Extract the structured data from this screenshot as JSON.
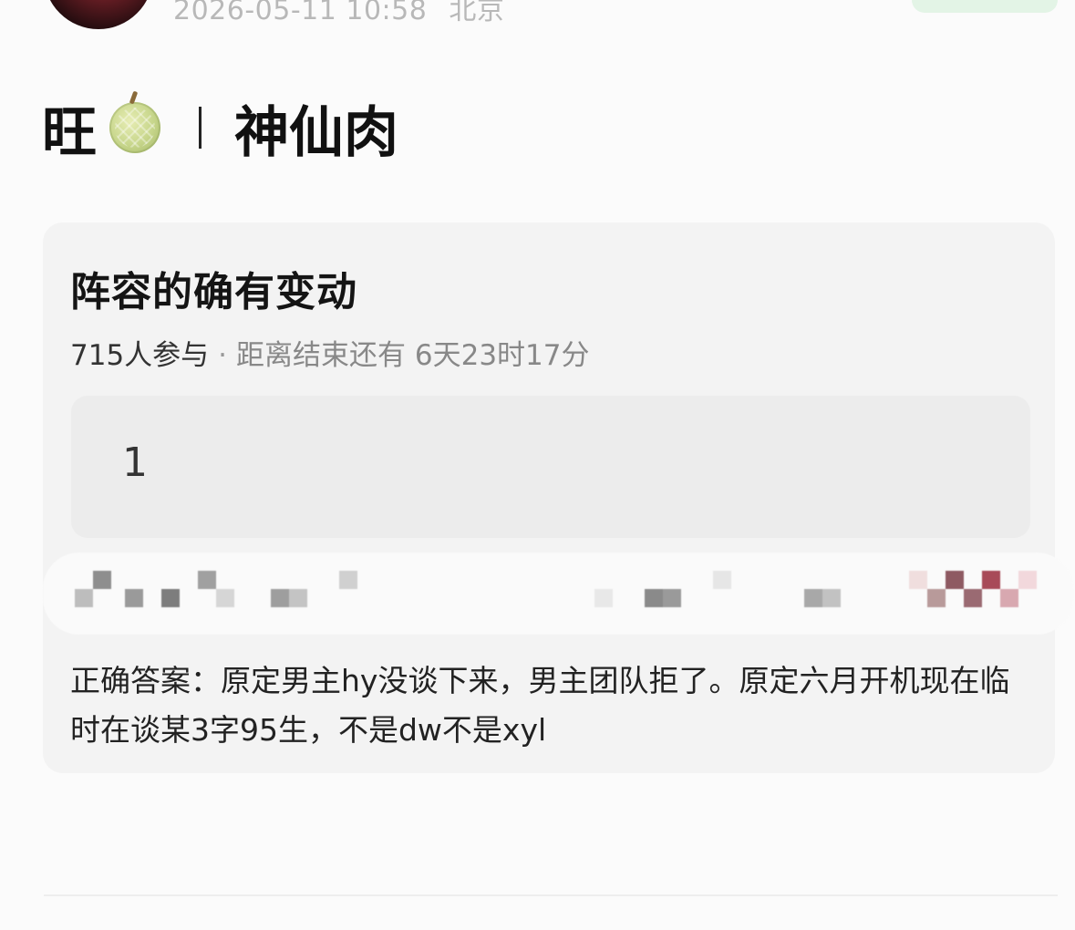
{
  "post": {
    "timestamp": "2026-05-11 10:58",
    "location": "北京",
    "title_left": "旺",
    "title_right": "神仙肉",
    "title_emoji": "melon-emoji"
  },
  "poll": {
    "title": "阵容的确有变动",
    "participants": "715人参与",
    "separator": "·",
    "time_remaining": "距离结束还有 6天23时17分",
    "options": [
      {
        "label": "1"
      }
    ],
    "answer": "正确答案：原定男主hy没谈下来，男主团队拒了。原定六月开机现在临时在谈某3字95生，不是dw不是xyl"
  },
  "colors": {
    "background": "#fbfbfb",
    "card": "#f3f3f3",
    "option": "#ececec",
    "follow_button": "#e3f4e6",
    "meta_text": "#b8b8b8"
  }
}
